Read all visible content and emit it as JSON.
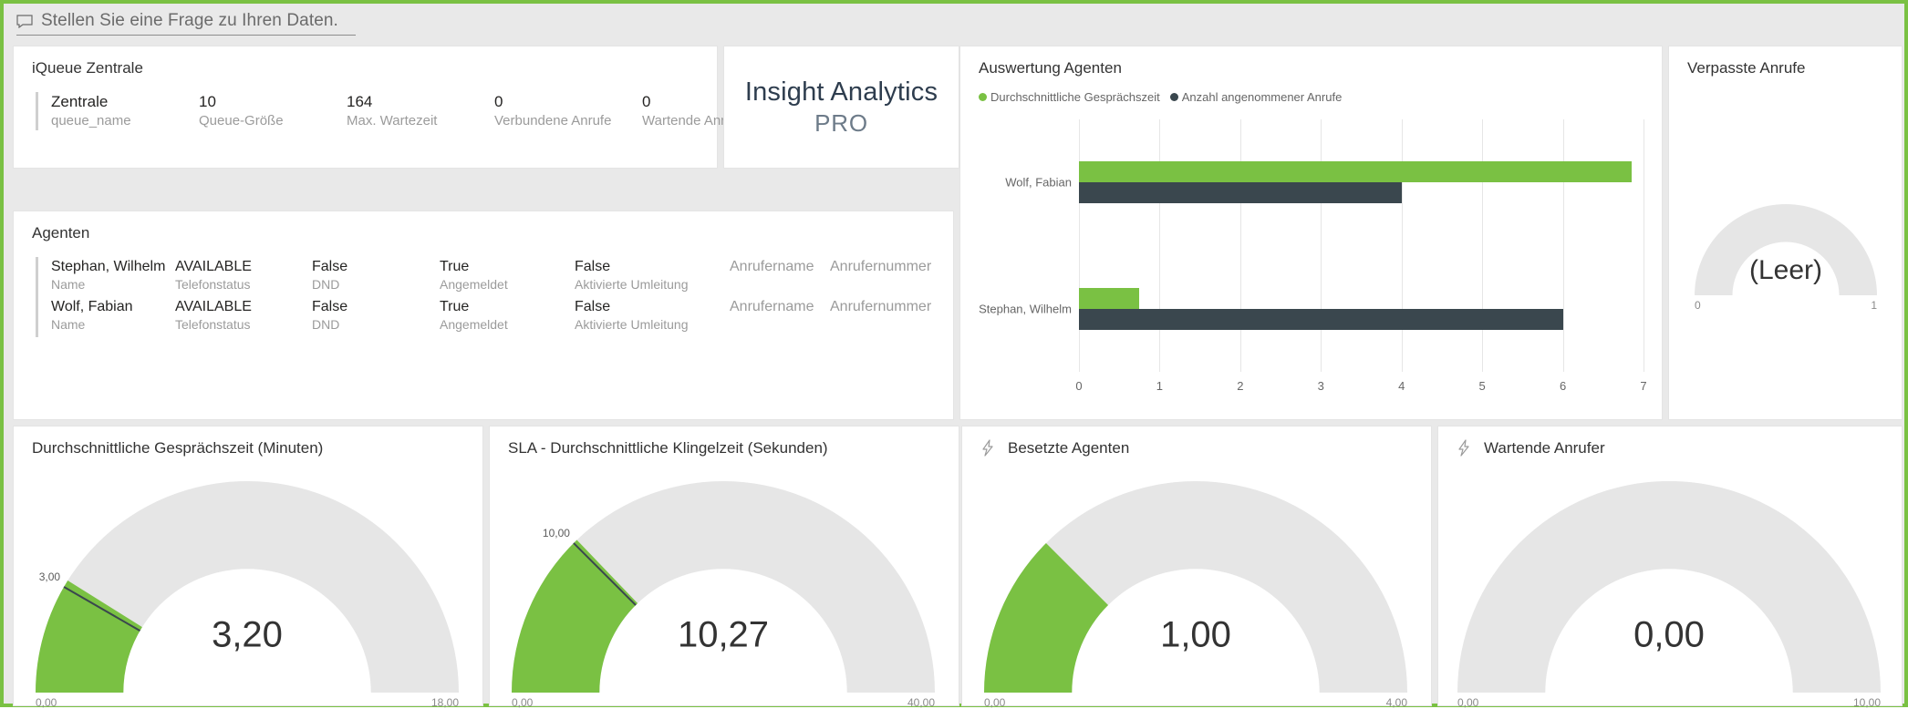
{
  "accent": {
    "green": "#7ac143",
    "dark": "#3a474e",
    "track": "#e6e6e6"
  },
  "qna": {
    "icon": "comment-icon",
    "placeholder": "Stellen Sie eine Frage zu Ihren Daten."
  },
  "queue_card": {
    "title": "iQueue Zentrale",
    "columns": [
      {
        "value": "Zentrale",
        "label": "queue_name"
      },
      {
        "value": "10",
        "label": "Queue-Größe"
      },
      {
        "value": "164",
        "label": "Max. Wartezeit"
      },
      {
        "value": "0",
        "label": "Verbundene Anrufe"
      },
      {
        "value": "0",
        "label": "Wartende Anrufe"
      }
    ]
  },
  "logo_tile": {
    "line1": "Insight Analytics",
    "line2": "PRO"
  },
  "agents_card": {
    "title": "Agenten",
    "labels": {
      "name": "Name",
      "phone_status": "Telefonstatus",
      "dnd": "DND",
      "logged_in": "Angemeldet",
      "forwarding": "Aktivierte Umleitung",
      "caller_name": "Anrufername",
      "caller_number": "Anrufernummer"
    },
    "rows": [
      {
        "name": "Stephan, Wilhelm",
        "phone_status": "AVAILABLE",
        "dnd": "False",
        "logged_in": "True",
        "forwarding": "False",
        "caller_name": "Anrufername",
        "caller_number": "Anrufernummer"
      },
      {
        "name": "Wolf, Fabian",
        "phone_status": "AVAILABLE",
        "dnd": "False",
        "logged_in": "True",
        "forwarding": "False",
        "caller_name": "Anrufername",
        "caller_number": "Anrufernummer"
      }
    ]
  },
  "chart_data": [
    {
      "id": "auswertung-agenten",
      "type": "bar",
      "orientation": "horizontal",
      "title": "Auswertung Agenten",
      "categories": [
        "Wolf, Fabian",
        "Stephan, Wilhelm"
      ],
      "series": [
        {
          "name": "Durchschnittliche Gesprächszeit",
          "color": "#7ac143",
          "values": [
            6.85,
            0.75
          ]
        },
        {
          "name": "Anzahl angenommener Anrufe",
          "color": "#3a474e",
          "values": [
            4.0,
            6.0
          ]
        }
      ],
      "xlabel": "",
      "ylabel": "",
      "xlim": [
        0,
        7
      ],
      "xticks": [
        "0",
        "1",
        "2",
        "3",
        "4",
        "5",
        "6",
        "7"
      ],
      "grid": true,
      "legend_position": "top-left"
    },
    {
      "id": "verpasste-anrufe",
      "type": "gauge",
      "title": "Verpasste Anrufe",
      "value": null,
      "value_label": "(Leer)",
      "min": 0,
      "max": 1,
      "min_label": "0",
      "max_label": "1",
      "target": null,
      "has_icon": false
    },
    {
      "id": "durchschnittliche-gespraechszeit",
      "type": "gauge",
      "title": "Durchschnittliche Gesprächszeit (Minuten)",
      "value": 3.2,
      "value_label": "3,20",
      "min": 0,
      "max": 18,
      "min_label": "0,00",
      "max_label": "18,00",
      "target": 3.0,
      "target_label": "3,00",
      "has_icon": false
    },
    {
      "id": "sla-klingelzeit",
      "type": "gauge",
      "title": "SLA - Durchschnittliche Klingelzeit (Sekunden)",
      "value": 10.27,
      "value_label": "10,27",
      "min": 0,
      "max": 40,
      "min_label": "0,00",
      "max_label": "40,00",
      "target": 10.0,
      "target_label": "10,00",
      "has_icon": false
    },
    {
      "id": "besetzte-agenten",
      "type": "gauge",
      "title": "Besetzte Agenten",
      "value": 1.0,
      "value_label": "1,00",
      "min": 0,
      "max": 4,
      "min_label": "0,00",
      "max_label": "4,00",
      "target": null,
      "has_icon": true,
      "icon": "lightning-bolt-icon"
    },
    {
      "id": "wartende-anrufer",
      "type": "gauge",
      "title": "Wartende Anrufer",
      "value": 0.0,
      "value_label": "0,00",
      "min": 0,
      "max": 10,
      "min_label": "0,00",
      "max_label": "10,00",
      "target": null,
      "has_icon": true,
      "icon": "lightning-bolt-icon"
    }
  ]
}
